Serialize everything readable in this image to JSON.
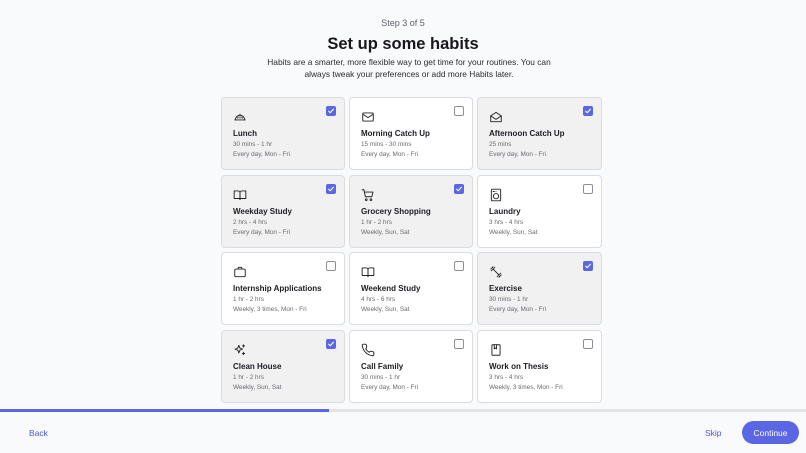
{
  "step": "Step 3 of 5",
  "title": "Set up some habits",
  "subtitle": "Habits are a smarter, more flexible way to get time for your routines. You can always tweak your preferences or add more Habits later.",
  "progress_fraction": 0.408,
  "accent_color": "#5a66e3",
  "habits": [
    {
      "name": "Lunch",
      "duration": "30 mins - 1 hr",
      "schedule": "Every day, Mon - Fri",
      "icon": "lunch-icon",
      "checked": true
    },
    {
      "name": "Morning Catch Up",
      "duration": "15 mins - 30 mins",
      "schedule": "Every day, Mon - Fri",
      "icon": "mail-icon",
      "checked": false
    },
    {
      "name": "Afternoon Catch Up",
      "duration": "25 mins",
      "schedule": "Every day, Mon - Fri",
      "icon": "mail-open-icon",
      "checked": true
    },
    {
      "name": "Weekday Study",
      "duration": "2 hrs - 4 hrs",
      "schedule": "Every day, Mon - Fri",
      "icon": "book-icon",
      "checked": true
    },
    {
      "name": "Grocery Shopping",
      "duration": "1 hr - 2 hrs",
      "schedule": "Weekly, Sun, Sat",
      "icon": "cart-icon",
      "checked": true
    },
    {
      "name": "Laundry",
      "duration": "3 hrs - 4 hrs",
      "schedule": "Weekly, Sun, Sat",
      "icon": "washing-machine-icon",
      "checked": false
    },
    {
      "name": "Internship Applications",
      "duration": "1 hr - 2 hrs",
      "schedule": "Weekly, 3 times, Mon - Fri",
      "icon": "briefcase-icon",
      "checked": false
    },
    {
      "name": "Weekend Study",
      "duration": "4 hrs - 6 hrs",
      "schedule": "Weekly, Sun, Sat",
      "icon": "book-icon",
      "checked": false
    },
    {
      "name": "Exercise",
      "duration": "30 mins - 1 hr",
      "schedule": "Every day, Mon - Fri",
      "icon": "dumbbell-icon",
      "checked": true
    },
    {
      "name": "Clean House",
      "duration": "1 hr - 2 hrs",
      "schedule": "Weekly, Sun, Sat",
      "icon": "sparkles-icon",
      "checked": true
    },
    {
      "name": "Call Family",
      "duration": "30 mins - 1 hr",
      "schedule": "Every day, Mon - Fri",
      "icon": "phone-icon",
      "checked": false
    },
    {
      "name": "Work on Thesis",
      "duration": "3 hrs - 4 hrs",
      "schedule": "Weekly, 3 times, Mon - Fri",
      "icon": "notebook-icon",
      "checked": false
    }
  ],
  "footer": {
    "back_label": "Back",
    "skip_label": "Skip",
    "continue_label": "Continue"
  }
}
